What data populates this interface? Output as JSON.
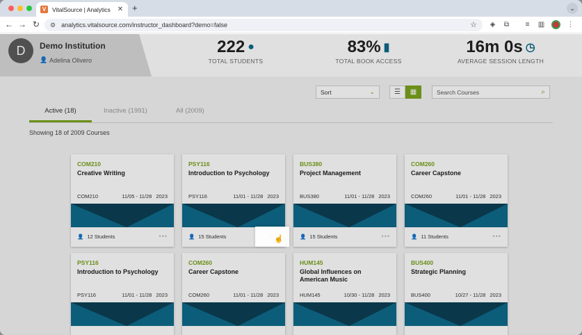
{
  "browser": {
    "tab_title": "VitalSource | Analytics",
    "favicon_letter": "V",
    "url": "analytics.vitalsource.com/instructor_dashboard?demo=false"
  },
  "institution": {
    "avatar_letter": "D",
    "name": "Demo Institution",
    "user": "Adelina Olivero"
  },
  "stats": [
    {
      "value": "222",
      "label": "TOTAL STUDENTS",
      "icon": "person-icon"
    },
    {
      "value": "83%",
      "label": "TOTAL BOOK ACCESS",
      "icon": "book-icon"
    },
    {
      "value": "16m 0s",
      "label": "AVERAGE SESSION LENGTH",
      "icon": "stopwatch-icon"
    }
  ],
  "controls": {
    "sort_label": "Sort",
    "search_placeholder": "Search Courses"
  },
  "tabs": [
    {
      "label": "Active (18)"
    },
    {
      "label": "Inactive (1991)"
    },
    {
      "label": "All (2009)"
    }
  ],
  "showing_text": "Showing 18 of 2009 Courses",
  "cards": [
    {
      "code": "COM210",
      "title": "Creative Writing",
      "meta_code": "COM210",
      "dates": "11/05 - 11/28",
      "year": "2023",
      "students": "12 Students"
    },
    {
      "code": "PSY116",
      "title": "Introduction to Psychology",
      "meta_code": "PSY116",
      "dates": "11/01 - 11/28",
      "year": "2023",
      "students": "15 Students"
    },
    {
      "code": "BUS380",
      "title": "Project Management",
      "meta_code": "BUS380",
      "dates": "11/01 - 11/28",
      "year": "2023",
      "students": "15 Students"
    },
    {
      "code": "COM260",
      "title": "Career Capstone",
      "meta_code": "COM260",
      "dates": "11/01 - 11/28",
      "year": "2023",
      "students": "11 Students"
    },
    {
      "code": "PSY116",
      "title": "Introduction to Psychology",
      "meta_code": "PSY116",
      "dates": "11/01 - 11/28",
      "year": "2023",
      "students": ""
    },
    {
      "code": "COM260",
      "title": "Career Capstone",
      "meta_code": "COM260",
      "dates": "11/01 - 11/28",
      "year": "2023",
      "students": ""
    },
    {
      "code": "HUM145",
      "title": "Global Influences on American Music",
      "meta_code": "HUM145",
      "dates": "10/30 - 11/28",
      "year": "2023",
      "students": ""
    },
    {
      "code": "BUS400",
      "title": "Strategic Planning",
      "meta_code": "BUS400",
      "dates": "10/27 - 11/28",
      "year": "2023",
      "students": ""
    }
  ],
  "colors": {
    "accent": "#7aa31c",
    "band_dark": "#0c3f55",
    "band_light": "#0e6a8a"
  }
}
